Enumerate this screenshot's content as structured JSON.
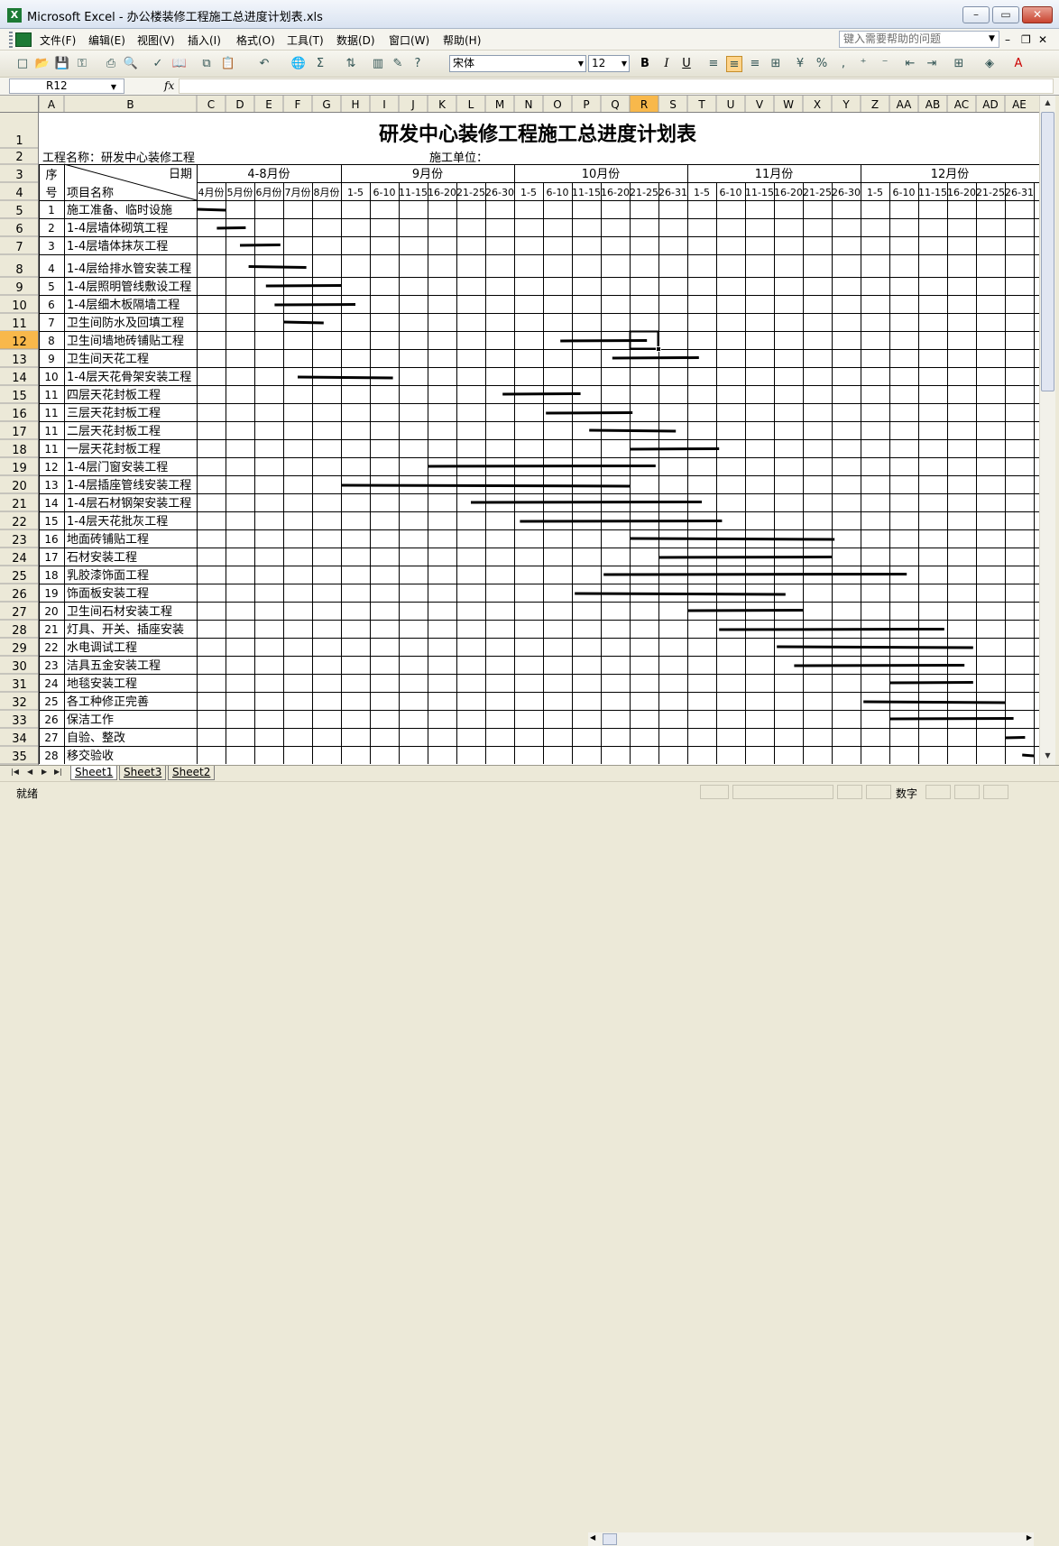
{
  "window": {
    "title": "Microsoft Excel - 办公楼装修工程施工总进度计划表.xls",
    "app_icon": "excel-icon"
  },
  "menu": {
    "items": [
      "文件(F)",
      "编辑(E)",
      "视图(V)",
      "插入(I)",
      "格式(O)",
      "工具(T)",
      "数据(D)",
      "窗口(W)",
      "帮助(H)"
    ],
    "help_placeholder": "键入需要帮助的问题"
  },
  "toolbar": {
    "font_name": "宋体",
    "font_size": "12",
    "bold_label": "B",
    "italic_label": "I",
    "underline_label": "U",
    "percent_label": "%",
    "comma_label": ","
  },
  "formula_bar": {
    "name_box": "R12",
    "fx_label": "fx",
    "formula": ""
  },
  "sheet": {
    "title": "研发中心装修工程施工总进度计划表",
    "project_label": "工程名称：研发中心装修工程",
    "contractor_label": "施工单位：",
    "header_seq": "序号",
    "header_seq_top": "序",
    "header_seq_bottom": "号",
    "header_date": "日期",
    "header_item": "项目名称",
    "selected_cell": "R12",
    "selected_row": "12",
    "selected_col": "R",
    "month_groups": [
      "4-8月份",
      "9月份",
      "10月份",
      "11月份",
      "12月份"
    ],
    "sub_periods": [
      "4月份",
      "5月份",
      "6月份",
      "7月份",
      "8月份",
      "1-5",
      "6-10",
      "11-15",
      "16-20",
      "21-25",
      "26-30",
      "1-5",
      "6-10",
      "11-15",
      "16-20",
      "21-25",
      "26-31",
      "1-5",
      "6-10",
      "11-15",
      "16-20",
      "21-25",
      "26-30",
      "1-5",
      "6-10",
      "11-15",
      "16-20",
      "21-25",
      "26-31"
    ],
    "columns": [
      "A",
      "B",
      "C",
      "D",
      "E",
      "F",
      "G",
      "H",
      "I",
      "J",
      "K",
      "L",
      "M",
      "N",
      "O",
      "P",
      "Q",
      "R",
      "S",
      "T",
      "U",
      "V",
      "W",
      "X",
      "Y",
      "Z",
      "AA",
      "AB",
      "AC",
      "AD",
      "AE"
    ],
    "row_numbers": [
      "1",
      "2",
      "3",
      "4",
      "5",
      "6",
      "7",
      "8",
      "9",
      "10",
      "11",
      "12",
      "13",
      "14",
      "15",
      "16",
      "17",
      "18",
      "19",
      "20",
      "21",
      "22",
      "23",
      "24",
      "25",
      "26",
      "27",
      "28",
      "29",
      "30",
      "31",
      "32",
      "33",
      "34",
      "35"
    ],
    "tasks": [
      {
        "seq": "1",
        "name": "施工准备、临时设施",
        "start": 0.0,
        "end": 1.0
      },
      {
        "seq": "2",
        "name": "1-4层墙体砌筑工程",
        "start": 0.7,
        "end": 1.7
      },
      {
        "seq": "3",
        "name": "1-4层墙体抹灰工程",
        "start": 1.5,
        "end": 2.9
      },
      {
        "seq": "4",
        "name": "1-4层给排水管安装工程",
        "start": 1.8,
        "end": 3.8
      },
      {
        "seq": "5",
        "name": "1-4层照明管线敷设工程",
        "start": 2.4,
        "end": 5.0
      },
      {
        "seq": "6",
        "name": "1-4层细木板隔墙工程",
        "start": 2.7,
        "end": 5.5
      },
      {
        "seq": "7",
        "name": "卫生间防水及回填工程",
        "start": 3.0,
        "end": 4.4
      },
      {
        "seq": "8",
        "name": "卫生间墙地砖铺贴工程",
        "start": 12.6,
        "end": 15.6
      },
      {
        "seq": "9",
        "name": "卫生间天花工程",
        "start": 14.4,
        "end": 17.4
      },
      {
        "seq": "10",
        "name": "1-4层天花骨架安装工程",
        "start": 3.5,
        "end": 6.8
      },
      {
        "seq": "11",
        "name": "四层天花封板工程",
        "start": 10.6,
        "end": 13.3
      },
      {
        "seq": "11",
        "name": "三层天花封板工程",
        "start": 12.1,
        "end": 15.1
      },
      {
        "seq": "11",
        "name": "二层天花封板工程",
        "start": 13.6,
        "end": 16.6
      },
      {
        "seq": "11",
        "name": "一层天花封板工程",
        "start": 15.0,
        "end": 18.1
      },
      {
        "seq": "12",
        "name": "1-4层门窗安装工程",
        "start": 8.0,
        "end": 15.9
      },
      {
        "seq": "13",
        "name": "1-4层插座管线安装工程",
        "start": 5.0,
        "end": 15.0
      },
      {
        "seq": "14",
        "name": "1-4层石材钢架安装工程",
        "start": 9.5,
        "end": 17.5
      },
      {
        "seq": "15",
        "name": "1-4层天花批灰工程",
        "start": 11.2,
        "end": 18.2
      },
      {
        "seq": "16",
        "name": "地面砖铺贴工程",
        "start": 15.0,
        "end": 22.1
      },
      {
        "seq": "17",
        "name": "石材安装工程",
        "start": 16.0,
        "end": 22.0
      },
      {
        "seq": "18",
        "name": "乳胶漆饰面工程",
        "start": 14.1,
        "end": 24.6
      },
      {
        "seq": "19",
        "name": "饰面板安装工程",
        "start": 13.1,
        "end": 20.4
      },
      {
        "seq": "20",
        "name": "卫生间石材安装工程",
        "start": 17.0,
        "end": 21.0
      },
      {
        "seq": "21",
        "name": "灯具、开关、插座安装",
        "start": 18.1,
        "end": 25.9
      },
      {
        "seq": "22",
        "name": "水电调试工程",
        "start": 20.1,
        "end": 26.9
      },
      {
        "seq": "23",
        "name": "洁具五金安装工程",
        "start": 20.7,
        "end": 26.6
      },
      {
        "seq": "24",
        "name": "地毯安装工程",
        "start": 24.0,
        "end": 26.9
      },
      {
        "seq": "25",
        "name": "各工种修正完善",
        "start": 23.1,
        "end": 28.0
      },
      {
        "seq": "26",
        "name": "保洁工作",
        "start": 24.0,
        "end": 28.3
      },
      {
        "seq": "27",
        "name": "自验、整改",
        "start": 28.0,
        "end": 28.7
      },
      {
        "seq": "28",
        "name": "移交验收",
        "start": 28.6,
        "end": 29.0
      }
    ]
  },
  "sheet_tabs": [
    "Sheet1",
    "Sheet3",
    "Sheet2"
  ],
  "status": {
    "ready": "就绪",
    "num": "数字"
  },
  "colors": {
    "selected_header": "#F8B84B",
    "grid": "#000000",
    "header_bg": "#ECE9D8",
    "bar": "#000000"
  }
}
